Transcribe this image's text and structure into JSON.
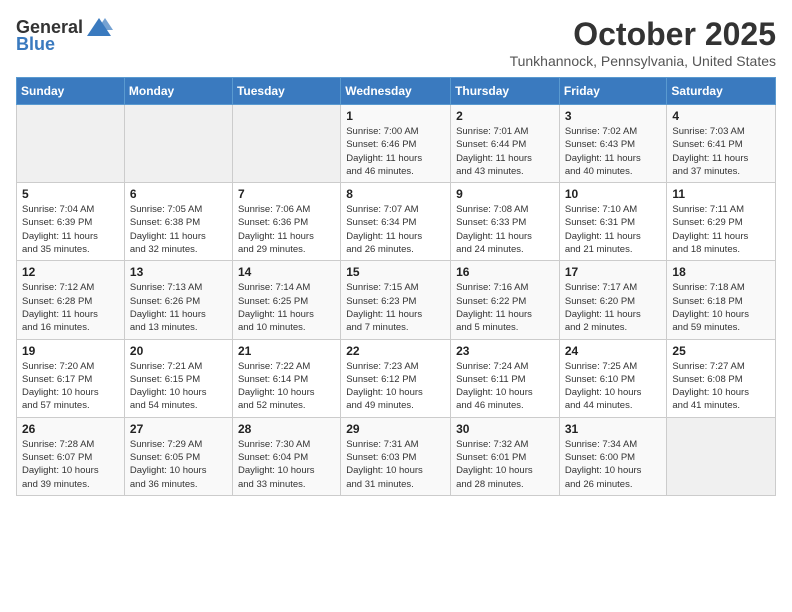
{
  "header": {
    "logo_general": "General",
    "logo_blue": "Blue",
    "month_year": "October 2025",
    "location": "Tunkhannock, Pennsylvania, United States"
  },
  "weekdays": [
    "Sunday",
    "Monday",
    "Tuesday",
    "Wednesday",
    "Thursday",
    "Friday",
    "Saturday"
  ],
  "weeks": [
    [
      {
        "day": "",
        "info": ""
      },
      {
        "day": "",
        "info": ""
      },
      {
        "day": "",
        "info": ""
      },
      {
        "day": "1",
        "info": "Sunrise: 7:00 AM\nSunset: 6:46 PM\nDaylight: 11 hours\nand 46 minutes."
      },
      {
        "day": "2",
        "info": "Sunrise: 7:01 AM\nSunset: 6:44 PM\nDaylight: 11 hours\nand 43 minutes."
      },
      {
        "day": "3",
        "info": "Sunrise: 7:02 AM\nSunset: 6:43 PM\nDaylight: 11 hours\nand 40 minutes."
      },
      {
        "day": "4",
        "info": "Sunrise: 7:03 AM\nSunset: 6:41 PM\nDaylight: 11 hours\nand 37 minutes."
      }
    ],
    [
      {
        "day": "5",
        "info": "Sunrise: 7:04 AM\nSunset: 6:39 PM\nDaylight: 11 hours\nand 35 minutes."
      },
      {
        "day": "6",
        "info": "Sunrise: 7:05 AM\nSunset: 6:38 PM\nDaylight: 11 hours\nand 32 minutes."
      },
      {
        "day": "7",
        "info": "Sunrise: 7:06 AM\nSunset: 6:36 PM\nDaylight: 11 hours\nand 29 minutes."
      },
      {
        "day": "8",
        "info": "Sunrise: 7:07 AM\nSunset: 6:34 PM\nDaylight: 11 hours\nand 26 minutes."
      },
      {
        "day": "9",
        "info": "Sunrise: 7:08 AM\nSunset: 6:33 PM\nDaylight: 11 hours\nand 24 minutes."
      },
      {
        "day": "10",
        "info": "Sunrise: 7:10 AM\nSunset: 6:31 PM\nDaylight: 11 hours\nand 21 minutes."
      },
      {
        "day": "11",
        "info": "Sunrise: 7:11 AM\nSunset: 6:29 PM\nDaylight: 11 hours\nand 18 minutes."
      }
    ],
    [
      {
        "day": "12",
        "info": "Sunrise: 7:12 AM\nSunset: 6:28 PM\nDaylight: 11 hours\nand 16 minutes."
      },
      {
        "day": "13",
        "info": "Sunrise: 7:13 AM\nSunset: 6:26 PM\nDaylight: 11 hours\nand 13 minutes."
      },
      {
        "day": "14",
        "info": "Sunrise: 7:14 AM\nSunset: 6:25 PM\nDaylight: 11 hours\nand 10 minutes."
      },
      {
        "day": "15",
        "info": "Sunrise: 7:15 AM\nSunset: 6:23 PM\nDaylight: 11 hours\nand 7 minutes."
      },
      {
        "day": "16",
        "info": "Sunrise: 7:16 AM\nSunset: 6:22 PM\nDaylight: 11 hours\nand 5 minutes."
      },
      {
        "day": "17",
        "info": "Sunrise: 7:17 AM\nSunset: 6:20 PM\nDaylight: 11 hours\nand 2 minutes."
      },
      {
        "day": "18",
        "info": "Sunrise: 7:18 AM\nSunset: 6:18 PM\nDaylight: 10 hours\nand 59 minutes."
      }
    ],
    [
      {
        "day": "19",
        "info": "Sunrise: 7:20 AM\nSunset: 6:17 PM\nDaylight: 10 hours\nand 57 minutes."
      },
      {
        "day": "20",
        "info": "Sunrise: 7:21 AM\nSunset: 6:15 PM\nDaylight: 10 hours\nand 54 minutes."
      },
      {
        "day": "21",
        "info": "Sunrise: 7:22 AM\nSunset: 6:14 PM\nDaylight: 10 hours\nand 52 minutes."
      },
      {
        "day": "22",
        "info": "Sunrise: 7:23 AM\nSunset: 6:12 PM\nDaylight: 10 hours\nand 49 minutes."
      },
      {
        "day": "23",
        "info": "Sunrise: 7:24 AM\nSunset: 6:11 PM\nDaylight: 10 hours\nand 46 minutes."
      },
      {
        "day": "24",
        "info": "Sunrise: 7:25 AM\nSunset: 6:10 PM\nDaylight: 10 hours\nand 44 minutes."
      },
      {
        "day": "25",
        "info": "Sunrise: 7:27 AM\nSunset: 6:08 PM\nDaylight: 10 hours\nand 41 minutes."
      }
    ],
    [
      {
        "day": "26",
        "info": "Sunrise: 7:28 AM\nSunset: 6:07 PM\nDaylight: 10 hours\nand 39 minutes."
      },
      {
        "day": "27",
        "info": "Sunrise: 7:29 AM\nSunset: 6:05 PM\nDaylight: 10 hours\nand 36 minutes."
      },
      {
        "day": "28",
        "info": "Sunrise: 7:30 AM\nSunset: 6:04 PM\nDaylight: 10 hours\nand 33 minutes."
      },
      {
        "day": "29",
        "info": "Sunrise: 7:31 AM\nSunset: 6:03 PM\nDaylight: 10 hours\nand 31 minutes."
      },
      {
        "day": "30",
        "info": "Sunrise: 7:32 AM\nSunset: 6:01 PM\nDaylight: 10 hours\nand 28 minutes."
      },
      {
        "day": "31",
        "info": "Sunrise: 7:34 AM\nSunset: 6:00 PM\nDaylight: 10 hours\nand 26 minutes."
      },
      {
        "day": "",
        "info": ""
      }
    ]
  ]
}
